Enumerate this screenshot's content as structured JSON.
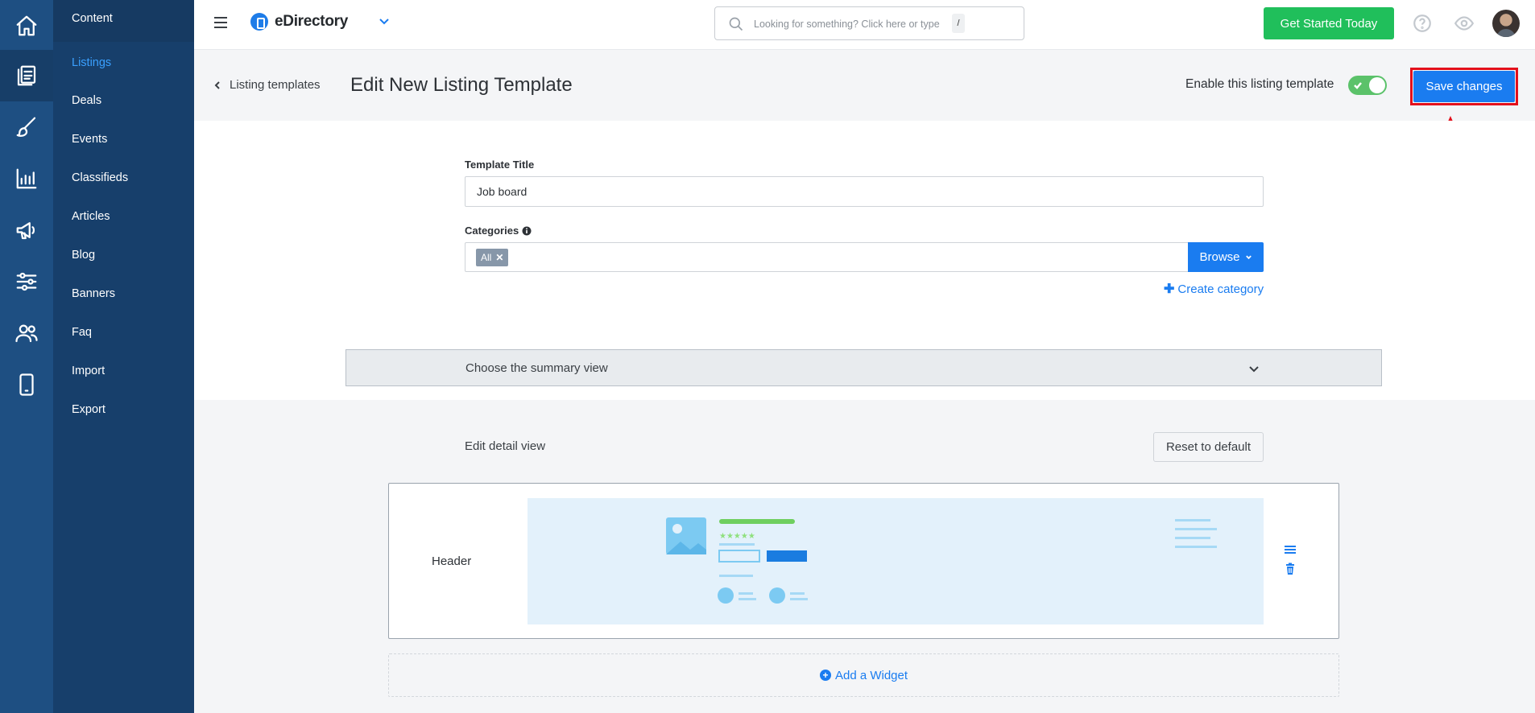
{
  "app": {
    "brand": "eDirectory"
  },
  "rail": {
    "items": [
      {
        "icon": "home-icon"
      },
      {
        "icon": "content-icon"
      },
      {
        "icon": "brush-icon"
      },
      {
        "icon": "reports-icon"
      },
      {
        "icon": "megaphone-icon"
      },
      {
        "icon": "settings-sliders-icon"
      },
      {
        "icon": "users-icon"
      },
      {
        "icon": "mobile-icon"
      }
    ]
  },
  "subnav": {
    "header": "Content",
    "items": [
      {
        "label": "Listings",
        "active": true
      },
      {
        "label": "Deals"
      },
      {
        "label": "Events"
      },
      {
        "label": "Classifieds"
      },
      {
        "label": "Articles"
      },
      {
        "label": "Blog"
      },
      {
        "label": "Banners"
      },
      {
        "label": "Faq"
      },
      {
        "label": "Import"
      },
      {
        "label": "Export"
      }
    ]
  },
  "topbar": {
    "search_placeholder": "Looking for something? Click here or type",
    "search_shortcut": "/",
    "cta_label": "Get Started Today"
  },
  "page": {
    "back_label": "Listing templates",
    "title": "Edit New Listing Template",
    "enable_label": "Enable this listing template",
    "enabled": true,
    "save_label": "Save changes"
  },
  "form": {
    "template_title_label": "Template Title",
    "template_title_value": "Job board",
    "categories_label": "Categories",
    "category_chips": [
      "All"
    ],
    "browse_label": "Browse",
    "create_category_label": "Create category",
    "summary_view_label": "Choose the summary view"
  },
  "detail": {
    "title": "Edit detail view",
    "reset_label": "Reset to default",
    "widgets": [
      {
        "name": "Header"
      }
    ],
    "add_widget_label": "Add a Widget"
  },
  "colors": {
    "rail": "#1e4f82",
    "subnav": "#173f6b",
    "accent": "#1a7cf0",
    "cta": "#20bf5b",
    "highlight": "#e3101c"
  }
}
